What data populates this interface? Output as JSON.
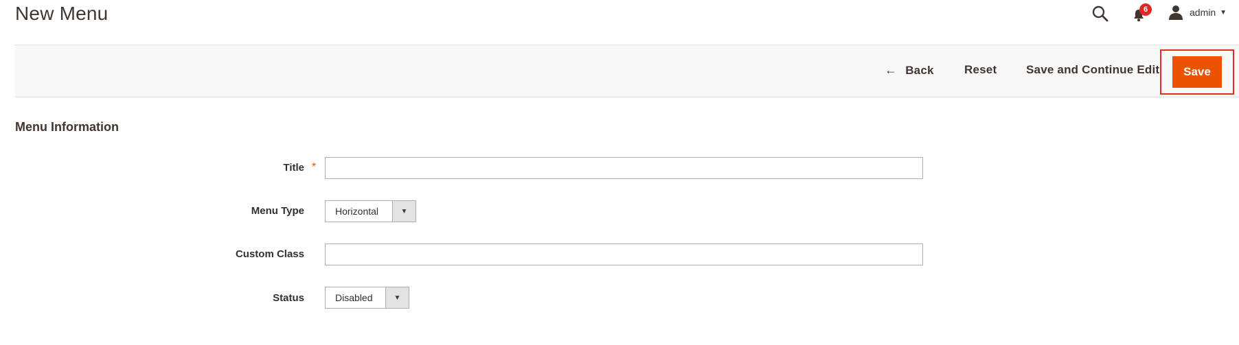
{
  "header": {
    "title": "New Menu",
    "notifications_count": "6",
    "user_name": "admin"
  },
  "actions": {
    "back_label": "Back",
    "reset_label": "Reset",
    "save_continue_label": "Save and Continue Edit",
    "save_label": "Save"
  },
  "section": {
    "title": "Menu Information"
  },
  "form": {
    "title_label": "Title",
    "title_value": "",
    "menu_type_label": "Menu Type",
    "menu_type_value": "Horizontal",
    "custom_class_label": "Custom Class",
    "custom_class_value": "",
    "status_label": "Status",
    "status_value": "Disabled"
  },
  "colors": {
    "accent": "#eb5202",
    "highlight_border": "#e02b27",
    "badge": "#e22626"
  },
  "icons": {
    "search": "search-icon",
    "notifications": "bell-icon",
    "user": "user-icon",
    "back": "arrow-left-icon",
    "dropdown": "triangle-down-icon"
  }
}
